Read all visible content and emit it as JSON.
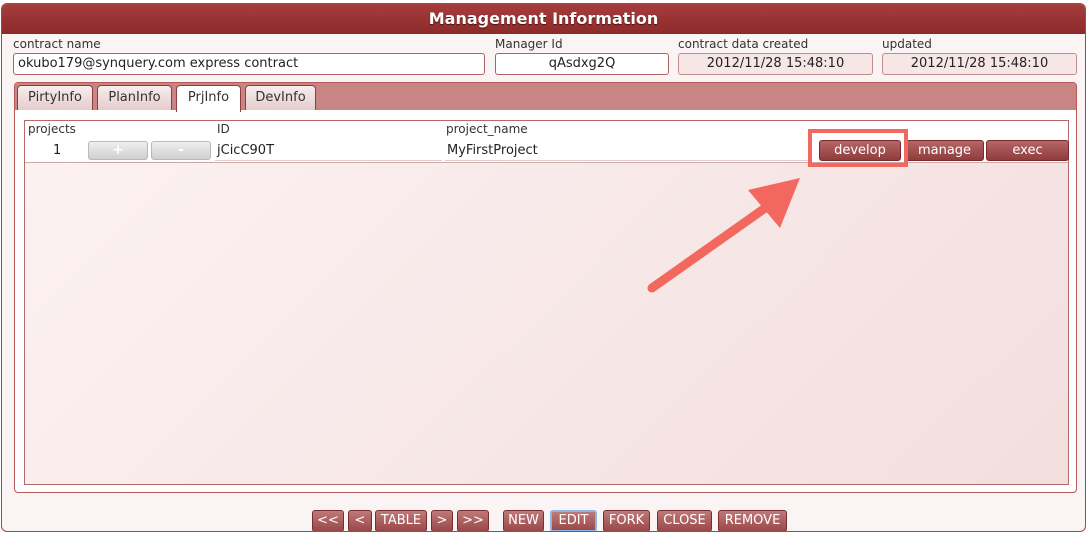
{
  "window": {
    "title": "Management Information"
  },
  "fields": {
    "contract_name": {
      "label": "contract name",
      "value": "okubo179@synquery.com express contract"
    },
    "manager_id": {
      "label": "Manager Id",
      "value": "qAsdxg2Q"
    },
    "created": {
      "label": "contract data created",
      "value": "2012/11/28 15:48:10"
    },
    "updated": {
      "label": "updated",
      "value": "2012/11/28 15:48:10"
    }
  },
  "tabs": [
    {
      "label": "PirtyInfo",
      "active": false
    },
    {
      "label": "PlanInfo",
      "active": false
    },
    {
      "label": "PrjInfo",
      "active": true
    },
    {
      "label": "DevInfo",
      "active": false
    }
  ],
  "grid": {
    "headers": {
      "projects": "projects",
      "id": "ID",
      "project_name": "project_name"
    },
    "rows": [
      {
        "index": "1",
        "add": "+",
        "remove": "-",
        "id": "jCicC90T",
        "project_name": "MyFirstProject",
        "develop": "develop",
        "manage": "manage",
        "exec": "exec"
      }
    ]
  },
  "nav": {
    "first": "<<",
    "prev": "<",
    "table": "TABLE",
    "next": ">",
    "last": ">>",
    "new": "NEW",
    "edit": "EDIT",
    "fork": "FORK",
    "close": "CLOSE",
    "remove": "REMOVE"
  },
  "colors": {
    "title_bar": "#9c3535",
    "annotation": "#f2675e",
    "action_button": "#9f4a4a"
  }
}
